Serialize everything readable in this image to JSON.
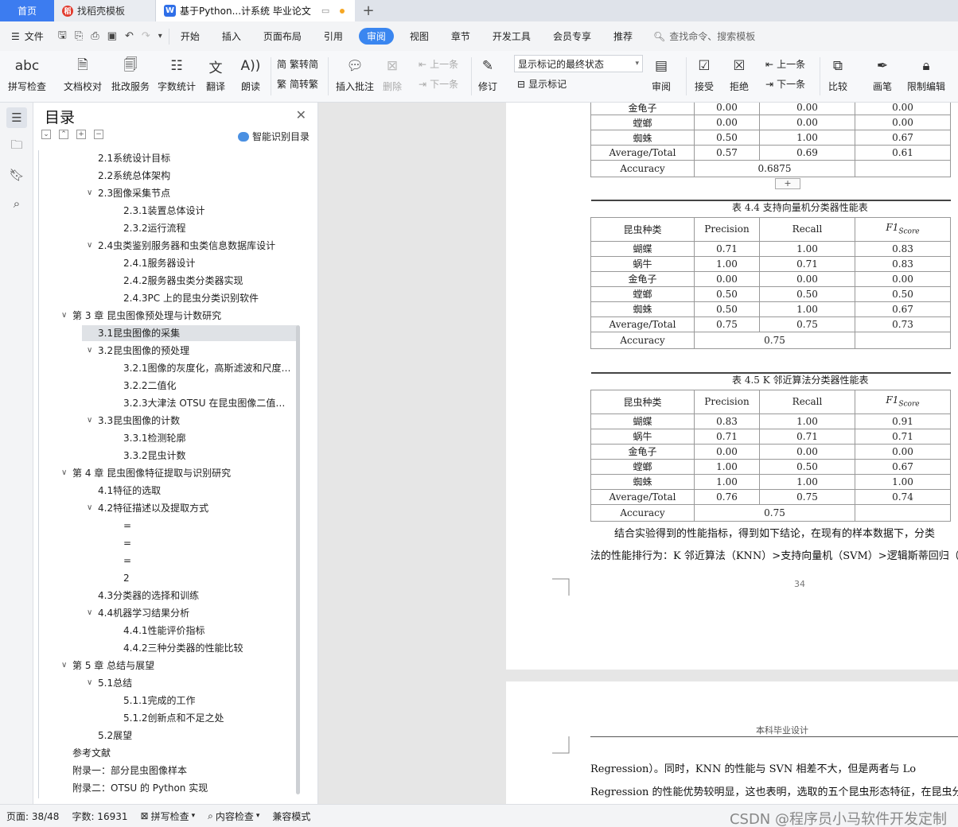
{
  "tabs": {
    "home": "首页",
    "daoke": "找稻壳模板",
    "doc": "基于Python...计系统 毕业论文",
    "add": "+"
  },
  "menu": {
    "file": "文件",
    "items": [
      "开始",
      "插入",
      "页面布局",
      "引用",
      "审阅",
      "视图",
      "章节",
      "开发工具",
      "会员专享",
      "推荐"
    ],
    "active": "审阅",
    "search": "查找命令、搜索模板"
  },
  "ribbon": {
    "spell": "拼写检查",
    "proof": "文档校对",
    "batch": "批改服务",
    "count": "字数统计",
    "translate": "翻译",
    "read": "朗读",
    "trad": "繁转简",
    "simp": "简转繁",
    "insert_comment": "插入批注",
    "delete": "删除",
    "prev_comment": "上一条",
    "next_comment": "下一条",
    "revise": "修订",
    "mode_select": "显示标记的最终状态",
    "show_marks": "显示标记",
    "review": "审阅",
    "accept": "接受",
    "reject": "拒绝",
    "prev": "上一条",
    "next": "下一条",
    "compare": "比较",
    "pen": "画笔",
    "restrict": "限制编辑"
  },
  "toc": {
    "title": "目录",
    "smart": "智能识别目录",
    "items": [
      {
        "text": "2.1系统设计目标",
        "level": 2
      },
      {
        "text": "2.2系统总体架构",
        "level": 2
      },
      {
        "text": "2.3图像采集节点",
        "level": 2,
        "chev": true
      },
      {
        "text": "2.3.1装置总体设计",
        "level": 3
      },
      {
        "text": "2.3.2运行流程",
        "level": 3
      },
      {
        "text": "2.4虫类鉴别服务器和虫类信息数据库设计",
        "level": 2,
        "chev": true
      },
      {
        "text": "2.4.1服务器设计",
        "level": 3
      },
      {
        "text": "2.4.2服务器虫类分类器实现",
        "level": 3
      },
      {
        "text": "2.4.3PC 上的昆虫分类识别软件",
        "level": 3
      },
      {
        "text": "第 3 章 昆虫图像预处理与计数研究",
        "level": 1,
        "chev": true
      },
      {
        "text": "3.1昆虫图像的采集",
        "level": 2,
        "sel": true
      },
      {
        "text": "3.2昆虫图像的预处理",
        "level": 2,
        "chev": true
      },
      {
        "text": "3.2.1图像的灰度化，高斯滤波和尺度…",
        "level": 3
      },
      {
        "text": "3.2.2二值化",
        "level": 3
      },
      {
        "text": "3.2.3大津法 OTSU 在昆虫图像二值化…",
        "level": 3
      },
      {
        "text": "3.3昆虫图像的计数",
        "level": 2,
        "chev": true
      },
      {
        "text": "3.3.1检测轮廓",
        "level": 3
      },
      {
        "text": "3.3.2昆虫计数",
        "level": 3
      },
      {
        "text": "第 4 章 昆虫图像特征提取与识别研究",
        "level": 1,
        "chev": true
      },
      {
        "text": "4.1特征的选取",
        "level": 2
      },
      {
        "text": "4.2特征描述以及提取方式",
        "level": 2,
        "chev": true
      },
      {
        "text": "=",
        "level": 3
      },
      {
        "text": "=",
        "level": 3
      },
      {
        "text": "=",
        "level": 3
      },
      {
        "text": "2",
        "level": 3
      },
      {
        "text": "4.3分类器的选择和训练",
        "level": 2
      },
      {
        "text": "4.4机器学习结果分析",
        "level": 2,
        "chev": true
      },
      {
        "text": "4.4.1性能评价指标",
        "level": 3
      },
      {
        "text": "4.4.2三种分类器的性能比较",
        "level": 3
      },
      {
        "text": "第 5 章 总结与展望",
        "level": 1,
        "chev": true
      },
      {
        "text": "5.1总结",
        "level": 2,
        "chev": true
      },
      {
        "text": "5.1.1完成的工作",
        "level": 3
      },
      {
        "text": "5.1.2创新点和不足之处",
        "level": 3
      },
      {
        "text": "5.2展望",
        "level": 2
      },
      {
        "text": "参考文献",
        "level": 1
      },
      {
        "text": "附录一：部分昆虫图像样本",
        "level": 1
      },
      {
        "text": "附录二：OTSU 的 Python 实现",
        "level": 1
      }
    ]
  },
  "doc": {
    "table_top": {
      "rows": [
        [
          "金龟子",
          "0.00",
          "0.00",
          "0.00"
        ],
        [
          "螳螂",
          "0.00",
          "0.00",
          "0.00"
        ],
        [
          "蜘蛛",
          "0.50",
          "1.00",
          "0.67"
        ],
        [
          "Average/Total",
          "0.57",
          "0.69",
          "0.61"
        ]
      ],
      "accuracy_label": "Accuracy",
      "accuracy": "0.6875"
    },
    "add_row": "+",
    "table_svm": {
      "caption": "表 4.4 支持向量机分类器性能表",
      "headers": [
        "昆虫种类",
        "Precision",
        "Recall",
        "F1"
      ],
      "f1_sub": "Score",
      "rows": [
        [
          "蝴蝶",
          "0.71",
          "1.00",
          "0.83"
        ],
        [
          "蜗牛",
          "1.00",
          "0.71",
          "0.83"
        ],
        [
          "金龟子",
          "0.00",
          "0.00",
          "0.00"
        ],
        [
          "螳螂",
          "0.50",
          "0.50",
          "0.50"
        ],
        [
          "蜘蛛",
          "0.50",
          "1.00",
          "0.67"
        ],
        [
          "Average/Total",
          "0.75",
          "0.75",
          "0.73"
        ]
      ],
      "accuracy_label": "Accuracy",
      "accuracy": "0.75"
    },
    "table_knn": {
      "caption": "表 4.5 K 邻近算法分类器性能表",
      "headers": [
        "昆虫种类",
        "Precision",
        "Recall",
        "F1"
      ],
      "f1_sub": "Score",
      "rows": [
        [
          "蝴蝶",
          "0.83",
          "1.00",
          "0.91"
        ],
        [
          "蜗牛",
          "0.71",
          "0.71",
          "0.71"
        ],
        [
          "金龟子",
          "0.00",
          "0.00",
          "0.00"
        ],
        [
          "螳螂",
          "1.00",
          "0.50",
          "0.67"
        ],
        [
          "蜘蛛",
          "1.00",
          "1.00",
          "1.00"
        ],
        [
          "Average/Total",
          "0.76",
          "0.75",
          "0.74"
        ]
      ],
      "accuracy_label": "Accuracy",
      "accuracy": "0.75"
    },
    "para1_line1": "结合实验得到的性能指标，得到如下结论，在现有的样本数据下，分类",
    "para1_line2": "法的性能排行为：K 邻近算法（KNN）>支持向量机（SVM）>逻辑斯蒂回归（Log",
    "page_number": "34",
    "next_header": "本科毕业设计",
    "para2_line1": "Regression）。同时，KNN 的性能与 SVN 相差不大，但是两者与 Lo",
    "para2_line2": "Regression 的性能优势较明显，这也表明，选取的五个昆虫形态特征，在昆虫分"
  },
  "status": {
    "page": "页面: 38/48",
    "words": "字数: 16931",
    "spell": "拼写检查",
    "content": "内容检查",
    "compat": "兼容模式",
    "watermark": "CSDN @程序员小马软件开发定制"
  }
}
